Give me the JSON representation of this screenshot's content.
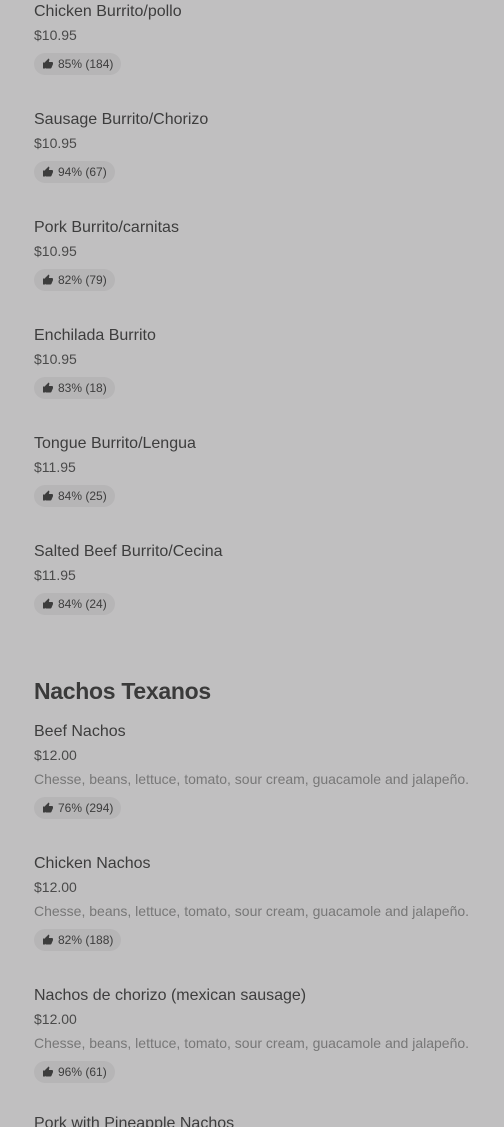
{
  "burrito_items": [
    {
      "name": "Chicken Burrito/pollo",
      "price": "$10.95",
      "rating": "85% (184)"
    },
    {
      "name": "Sausage Burrito/Chorizo",
      "price": "$10.95",
      "rating": "94% (67)"
    },
    {
      "name": "Pork Burrito/carnitas",
      "price": "$10.95",
      "rating": "82% (79)"
    },
    {
      "name": "Enchilada Burrito",
      "price": "$10.95",
      "rating": "83% (18)"
    },
    {
      "name": "Tongue Burrito/Lengua",
      "price": "$11.95",
      "rating": "84% (25)"
    },
    {
      "name": "Salted Beef Burrito/Cecina",
      "price": "$11.95",
      "rating": "84% (24)"
    }
  ],
  "nachos_section": {
    "title": "Nachos Texanos",
    "items": [
      {
        "name": "Beef Nachos",
        "price": "$12.00",
        "description": "Chesse, beans, lettuce, tomato, sour cream, guacamole and jalapeño.",
        "rating": "76% (294)"
      },
      {
        "name": "Chicken Nachos",
        "price": "$12.00",
        "description": "Chesse, beans, lettuce, tomato, sour cream, guacamole and jalapeño.",
        "rating": "82% (188)"
      },
      {
        "name": "Nachos de chorizo (mexican sausage)",
        "price": "$12.00",
        "description": "Chesse, beans, lettuce, tomato, sour cream, guacamole and jalapeño.",
        "rating": "96% (61)"
      },
      {
        "name": "Pork with Pineapple Nachos"
      }
    ]
  },
  "icons": {
    "rating": "thumbs-up-icon"
  },
  "colors": {
    "background": "#c0bfc0",
    "rating_pill": "#b6b5b6",
    "description_text": "#777777"
  }
}
